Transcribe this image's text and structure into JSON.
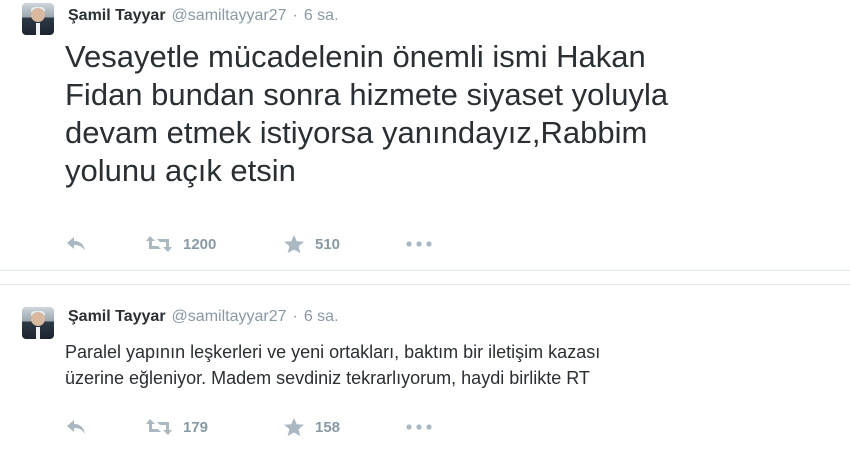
{
  "tweets": [
    {
      "name": "Şamil Tayyar",
      "handle": "@samiltayyar27",
      "separator": "·",
      "time": "6 sa.",
      "lines": [
        "Vesayetle mücadelenin önemli ismi Hakan",
        "Fidan bundan sonra hizmete siyaset yoluyla",
        "devam etmek istiyorsa yanındayız,Rabbim",
        "yolunu açık etsin"
      ],
      "retweets": "1200",
      "favorites": "510",
      "icons": [
        "reply-icon",
        "retweet-icon",
        "favorite-icon",
        "more-icon"
      ]
    },
    {
      "name": "Şamil Tayyar",
      "handle": "@samiltayyar27",
      "separator": "·",
      "time": "6 sa.",
      "lines": [
        "Paralel yapının leşkerleri ve yeni ortakları, baktım bir iletişim kazası",
        "üzerine eğleniyor. Madem sevdiniz tekrarlıyorum, haydi birlikte RT"
      ],
      "retweets": "179",
      "favorites": "158",
      "icons": [
        "reply-icon",
        "retweet-icon",
        "favorite-icon",
        "more-icon"
      ]
    }
  ],
  "colors": {
    "text": "#292f33",
    "muted": "#8899a6",
    "divider": "#e1e8ed"
  }
}
